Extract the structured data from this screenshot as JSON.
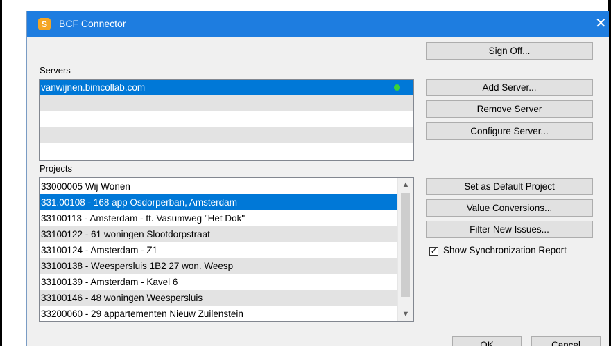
{
  "window": {
    "title": "BCF Connector",
    "app_icon_letter": "S"
  },
  "servers": {
    "label": "Servers",
    "items": [
      {
        "name": "vanwijnen.bimcollab.com",
        "status_color": "#39d23a",
        "selected": true
      }
    ]
  },
  "projects": {
    "label": "Projects",
    "items": [
      "33000005 Wij Wonen",
      "331.00108 - 168 app Osdorperban, Amsterdam",
      "33100113 - Amsterdam - tt. Vasumweg \"Het Dok\"",
      "33100122 - 61 woningen Slootdorpstraat",
      "33100124 - Amsterdam - Z1",
      "33100138 - Weespersluis 1B2 27 won. Weesp",
      "33100139 - Amsterdam - Kavel 6",
      "33100146 - 48 woningen Weespersluis",
      "33200060 - 29 appartementen Nieuw Zuilenstein"
    ],
    "selected_index": 1
  },
  "buttons": {
    "sign_off": "Sign Off...",
    "add_server": "Add Server...",
    "remove_server": "Remove Server",
    "configure_server": "Configure Server...",
    "set_default_project": "Set as Default Project",
    "value_conversions": "Value Conversions...",
    "filter_new_issues": "Filter New Issues...",
    "ok": "OK",
    "cancel": "Cancel"
  },
  "options": {
    "show_sync_report": {
      "label": "Show Synchronization Report",
      "checked": true
    }
  },
  "colors": {
    "titlebar": "#1e7de0",
    "selection": "#0078d7",
    "app_icon": "#f5a623"
  }
}
